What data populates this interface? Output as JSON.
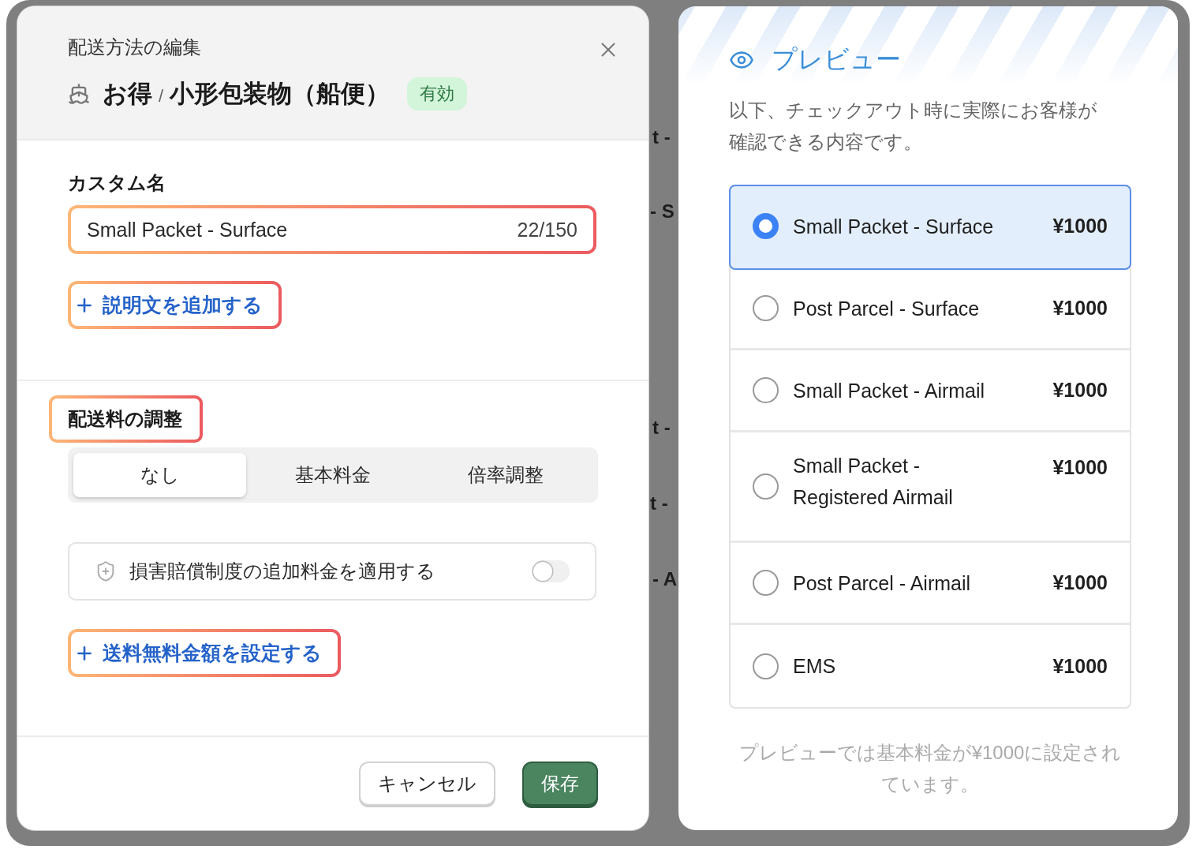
{
  "backdrop": {
    "fragments": [
      "t -",
      "- S",
      "t -",
      "t -",
      "- A"
    ]
  },
  "dialog": {
    "subtitle": "配送方法の編集",
    "title": {
      "prefix": "お得",
      "separator": "/",
      "name": "小形包装物（船便）"
    },
    "status_badge": "有効",
    "custom_name": {
      "label": "カスタム名",
      "value": "Small Packet - Surface",
      "counter": "22/150",
      "highlighted": true
    },
    "add_description_link": {
      "label": "説明文を追加する",
      "highlighted": true
    },
    "fee_adjustment": {
      "label": "配送料の調整",
      "highlighted": true,
      "options": [
        {
          "label": "なし",
          "selected": true
        },
        {
          "label": "基本料金",
          "selected": false
        },
        {
          "label": "倍率調整",
          "selected": false
        }
      ]
    },
    "insurance": {
      "label": "損害賠償制度の追加料金を適用する",
      "on": false
    },
    "free_shipping_link": {
      "label": "送料無料金額を設定する",
      "highlighted": true
    },
    "buttons": [
      {
        "label": "キャンセル",
        "kind": "secondary"
      },
      {
        "label": "保存",
        "kind": "primary"
      }
    ]
  },
  "preview": {
    "title": "プレビュー",
    "description": "以下、チェックアウト時に実際にお客様が確認できる内容です。",
    "options": [
      {
        "name": "Small Packet - Surface",
        "price": "¥1000",
        "selected": true
      },
      {
        "name": "Post Parcel - Surface",
        "price": "¥1000",
        "selected": false
      },
      {
        "name": "Small Packet - Airmail",
        "price": "¥1000",
        "selected": false
      },
      {
        "name": "Small Packet - Registered Airmail",
        "price": "¥1000",
        "selected": false
      },
      {
        "name": "Post Parcel - Airmail",
        "price": "¥1000",
        "selected": false
      },
      {
        "name": "EMS",
        "price": "¥1000",
        "selected": false
      }
    ],
    "note": "プレビューでは基本料金が¥1000に設定されています。"
  }
}
